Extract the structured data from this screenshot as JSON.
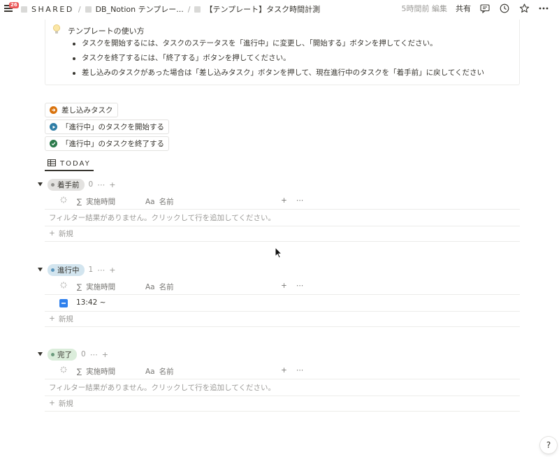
{
  "topbar": {
    "badge": "26",
    "breadcrumb": {
      "workspace": "SHARED",
      "parent": "DB_Notion テンプレー...",
      "current": "【テンプレート】タスク時間計測",
      "separator": "/"
    },
    "edited": "5時間前 編集",
    "share": "共有",
    "icons": [
      "comment-icon",
      "history-icon",
      "star-icon",
      "more-icon"
    ]
  },
  "callout": {
    "icon": "lightbulb-icon",
    "title": "テンプレートの使い方",
    "items": [
      "タスクを開始するには、タスクのステータスを「進行中」に変更し、「開始する」ボタンを押してください。",
      "タスクを終了するには、「終了する」ボタンを押してください。",
      "差し込みのタスクがあった場合は「差し込みタスク」ボタンを押して、現在進行中のタスクを「着手前」に戻してください"
    ]
  },
  "buttons": [
    {
      "label": "差し込みタスク",
      "icon": "arrow-right-circle-icon",
      "color": "#d9730d"
    },
    {
      "label": "「進行中」のタスクを開始する",
      "icon": "play-circle-icon",
      "color": "#2e7da6"
    },
    {
      "label": "「進行中」のタスクを終了する",
      "icon": "check-circle-icon",
      "color": "#2b7a4b"
    }
  ],
  "view": {
    "label": "TODAY",
    "icon": "table-icon"
  },
  "columns": {
    "time": "実施時間",
    "time_prefix": "∑",
    "name": "名前",
    "name_prefix": "Aa"
  },
  "groups": [
    {
      "status": "着手前",
      "count": "0",
      "pill_color": "#e3e2e0",
      "dot_color": "#91918e",
      "empty_text": "フィルター結果がありません。クリックして行を追加してください。",
      "new_label": "新規"
    },
    {
      "status": "進行中",
      "count": "1",
      "pill_color": "#d3e5ef",
      "dot_color": "#5b97bd",
      "row_time": "13:42 ~",
      "new_label": "新規"
    },
    {
      "status": "完了",
      "count": "0",
      "pill_color": "#dbeddb",
      "dot_color": "#6c9b7d",
      "empty_text": "フィルター結果がありません。クリックして行を追加してください。",
      "new_label": "新規"
    }
  ],
  "help": "?"
}
